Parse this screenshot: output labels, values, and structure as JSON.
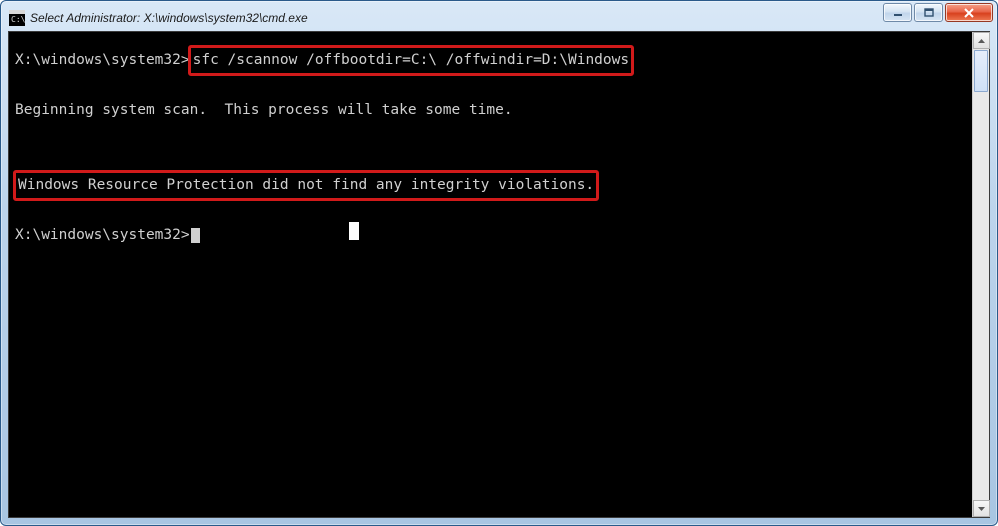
{
  "window": {
    "title": "Select Administrator: X:\\windows\\system32\\cmd.exe",
    "icon": "cmd-icon"
  },
  "controls": {
    "minimize": "minimize-button",
    "maximize": "maximize-button",
    "close": "close-button"
  },
  "terminal": {
    "prompt1": "X:\\windows\\system32>",
    "command": "sfc /scannow /offbootdir=C:\\ /offwindir=D:\\Windows",
    "blank": "",
    "status_line": "Beginning system scan.  This process will take some time.",
    "result_line": "Windows Resource Protection did not find any integrity violations.",
    "prompt2": "X:\\windows\\system32>"
  },
  "highlights": {
    "cmd_color": "#d11a1a",
    "result_color": "#d11a1a"
  }
}
